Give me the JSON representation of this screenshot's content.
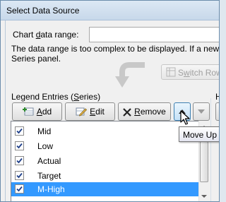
{
  "dialog": {
    "title": "Select Data Source",
    "chart_range": {
      "label_pre": "Chart ",
      "label_ul": "d",
      "label_post": "ata range:",
      "value": ""
    },
    "message_line1": "The data range is too complex to be displayed. If a new ra",
    "message_line2": "Series panel.",
    "switch_button": {
      "label_pre": "S",
      "label_ul": "w",
      "label_post": "itch Row"
    }
  },
  "legend_entries": {
    "label_pre": "Legend Entries (",
    "label_ul": "S",
    "label_post": "eries)",
    "right_fragment": "H",
    "toolbar": {
      "add_ul": "A",
      "add_post": "dd",
      "edit_ul": "E",
      "edit_post": "dit",
      "remove_ul": "R",
      "remove_post": "emove"
    },
    "items": [
      {
        "label": "Mid",
        "checked": true,
        "selected": false
      },
      {
        "label": "Low",
        "checked": true,
        "selected": false
      },
      {
        "label": "Actual",
        "checked": true,
        "selected": false
      },
      {
        "label": "Target",
        "checked": true,
        "selected": false
      },
      {
        "label": "M-High",
        "checked": true,
        "selected": true
      }
    ],
    "tooltip": "Move Up"
  },
  "colors": {
    "selection": "#3399ff",
    "titlebar": "#c7d8ea",
    "check": "#1e3f8a"
  },
  "icons": {
    "add": "add-row-icon",
    "edit": "edit-pencil-icon",
    "remove": "remove-x-icon",
    "up": "triangle-up-icon",
    "down": "triangle-down-icon",
    "switch": "switch-row-column-icon",
    "cursor": "mouse-pointer-icon"
  }
}
